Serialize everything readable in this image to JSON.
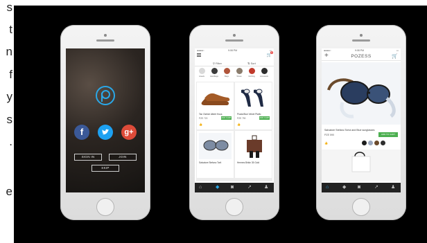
{
  "page_left_letters": [
    "s",
    "t",
    "n",
    "f",
    "y",
    "s",
    ".",
    "e"
  ],
  "phone_login": {
    "logo_icon": "pozess-p-logo",
    "social": [
      {
        "label": "f",
        "icon": "facebook-icon",
        "color": "#3b5998"
      },
      {
        "label": "t",
        "icon": "twitter-icon",
        "color": "#1da1f2"
      },
      {
        "label": "g+",
        "icon": "google-plus-icon",
        "color": "#dd4b39"
      }
    ],
    "sign_in_label": "SIGN IN",
    "join_label": "JOIN",
    "skip_label": "SKIP"
  },
  "phone_listing": {
    "status": {
      "time": "9:08 PM"
    },
    "cart_count": "1",
    "filter_label": "Filter",
    "sort_label": "Sort",
    "categories": [
      "Jewels",
      "Handbags",
      "Bags",
      "Shoes",
      "Clothing",
      "Accessories"
    ],
    "products": [
      {
        "name": "Tan Ostrich Albert Hous",
        "price": "PZE 720",
        "cart_label": "ADD CART"
      },
      {
        "name": "Prada Blue Velvet Platfo",
        "price": "PZE 790",
        "cart_label": "ADD CART"
      },
      {
        "name": "Salvatore Stefano Torti",
        "price": "",
        "cart_label": ""
      },
      {
        "name": "Hermes Birkin 35 Gold",
        "price": "",
        "cart_label": ""
      }
    ],
    "tabs": [
      "home-icon",
      "bag-icon",
      "camera-icon",
      "trending-icon",
      "profile-icon"
    ],
    "active_tab": 1
  },
  "phone_detail": {
    "status": {
      "time": "9:08 PM"
    },
    "brand": "POZESS",
    "cart_count": "1",
    "product_name": "Salvatore Stefano Tortoi and Blue sunglasses",
    "price": "PZE 590",
    "cart_label": "ADD TO CART",
    "tabs": [
      "home-icon",
      "bag-icon",
      "camera-icon",
      "trending-icon",
      "profile-icon"
    ],
    "active_tab": 0
  },
  "colors": {
    "accent": "#2aa8e8",
    "add_cart": "#4caf50",
    "tabbar": "#232323"
  }
}
